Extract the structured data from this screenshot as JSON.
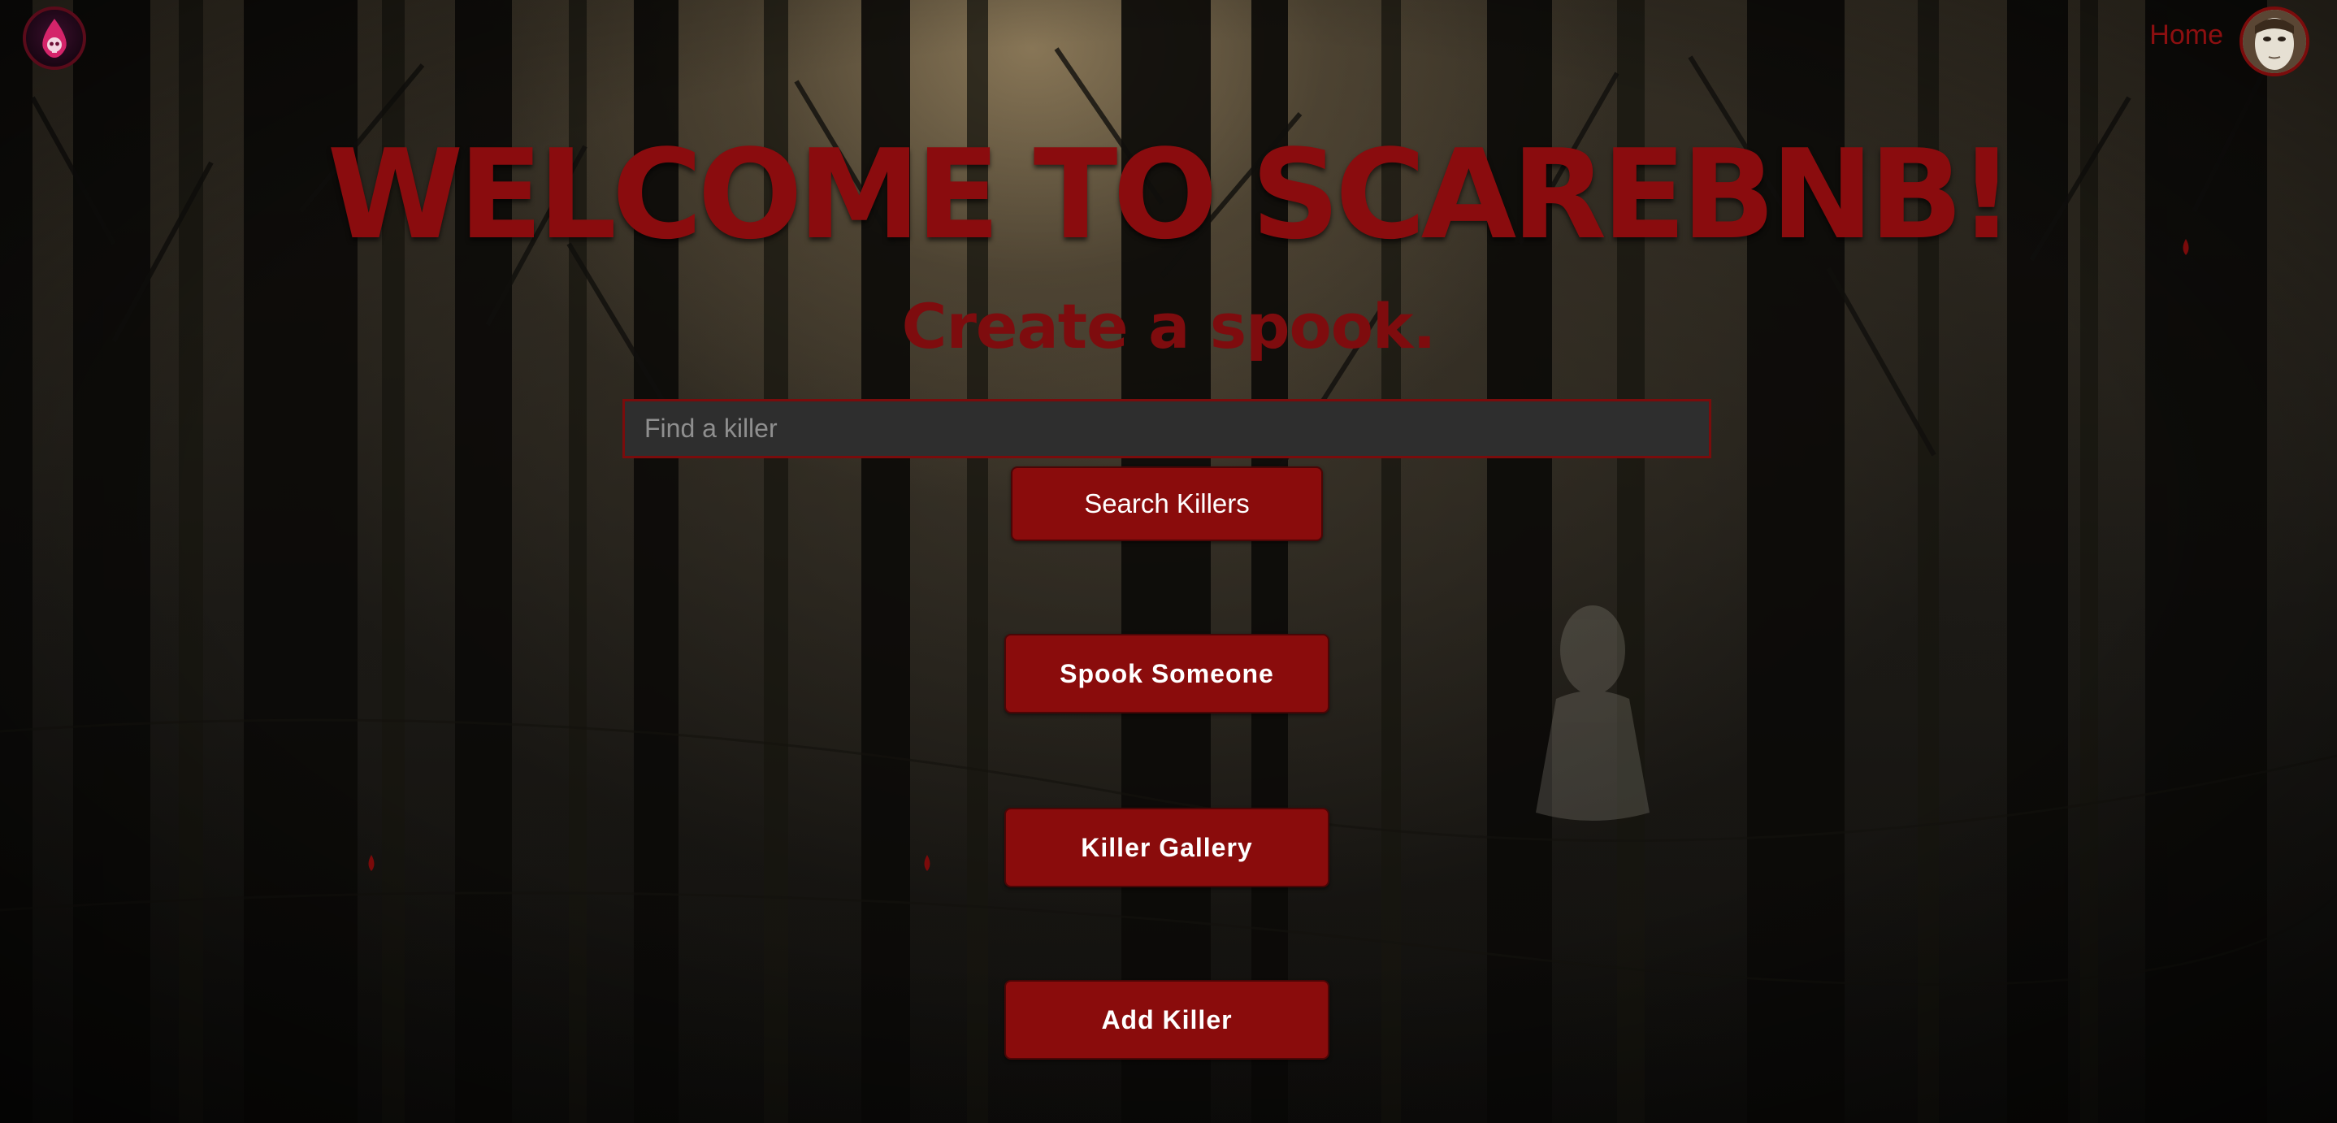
{
  "nav": {
    "home_label": "Home"
  },
  "hero": {
    "title": "WELCOME TO SCAREBNB!",
    "subtitle": "Create a spook."
  },
  "search": {
    "placeholder": "Find a killer",
    "value": "",
    "button_label": "Search Killers"
  },
  "actions": [
    {
      "label": "Spook Someone"
    },
    {
      "label": "Killer Gallery"
    },
    {
      "label": "Add Killer"
    }
  ],
  "colors": {
    "accent": "#8a0c0c",
    "title": "#8a0c0e",
    "input_bg": "#2e2e2e"
  }
}
